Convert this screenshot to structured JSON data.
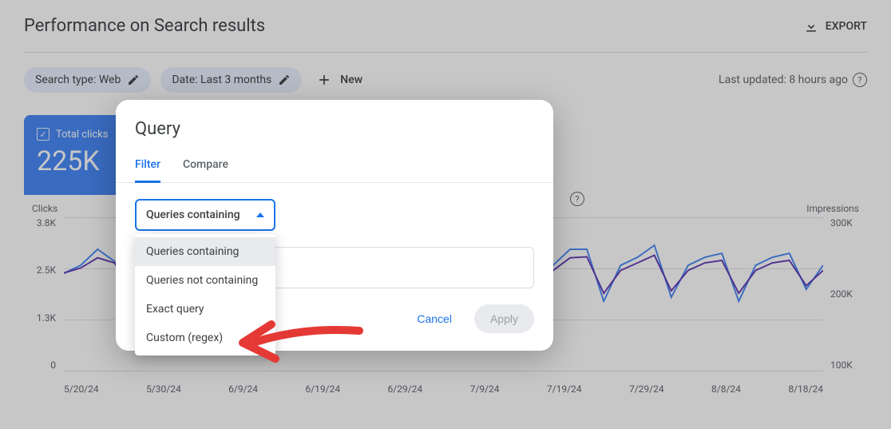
{
  "header": {
    "title": "Performance on Search results",
    "export_label": "EXPORT"
  },
  "filters": {
    "search_type_chip": "Search type: Web",
    "date_chip": "Date: Last 3 months",
    "new_label": "New",
    "last_updated": "Last updated: 8 hours ago"
  },
  "metrics": {
    "total_clicks_label": "Total clicks",
    "total_clicks_value": "225K"
  },
  "chart_data": {
    "type": "line",
    "title": "",
    "xlabel": "",
    "ylabel_left": "Clicks",
    "ylabel_right": "Impressions",
    "x_ticks": [
      "5/20/24",
      "5/30/24",
      "6/9/24",
      "6/19/24",
      "6/29/24",
      "7/9/24",
      "7/19/24",
      "7/29/24",
      "8/8/24",
      "8/18/24"
    ],
    "y_left_ticks": [
      "3.8K",
      "2.5K",
      "1.3K",
      "0"
    ],
    "y_right_ticks": [
      "300K",
      "200K",
      "100K"
    ],
    "ylim_left": [
      0,
      3800
    ],
    "ylim_right": [
      0,
      300000
    ],
    "series": [
      {
        "name": "Clicks",
        "axis": "left",
        "color": "#4285f4",
        "values": [
          2400,
          2600,
          3000,
          2700,
          1600,
          2000,
          2700,
          2800,
          2200,
          2600,
          2800,
          2900,
          2000,
          2500,
          2700,
          2900,
          1900,
          2500,
          2800,
          2900,
          1700,
          2500,
          2800,
          3000,
          1700,
          2600,
          2900,
          3000,
          1700,
          2600,
          3000,
          3000,
          1700,
          2600,
          2800,
          3100,
          1800,
          2600,
          2800,
          2900,
          1700,
          2600,
          2800,
          2900,
          2000,
          2600
        ]
      },
      {
        "name": "Impressions",
        "axis": "right",
        "color": "#5e35b1",
        "values": [
          190000,
          200000,
          220000,
          210000,
          150000,
          170000,
          200000,
          210000,
          175000,
          195000,
          210000,
          215000,
          165000,
          190000,
          205000,
          215000,
          160000,
          190000,
          210000,
          215000,
          150000,
          190000,
          210000,
          220000,
          150000,
          195000,
          215000,
          220000,
          150000,
          195000,
          220000,
          222000,
          150000,
          195000,
          210000,
          225000,
          155000,
          195000,
          210000,
          215000,
          150000,
          195000,
          210000,
          215000,
          165000,
          195000
        ]
      }
    ]
  },
  "dialog": {
    "title": "Query",
    "tabs": {
      "filter": "Filter",
      "compare": "Compare"
    },
    "select_label": "Queries containing",
    "options": [
      "Queries containing",
      "Queries not containing",
      "Exact query",
      "Custom (regex)"
    ],
    "actions": {
      "cancel": "Cancel",
      "apply": "Apply"
    }
  }
}
